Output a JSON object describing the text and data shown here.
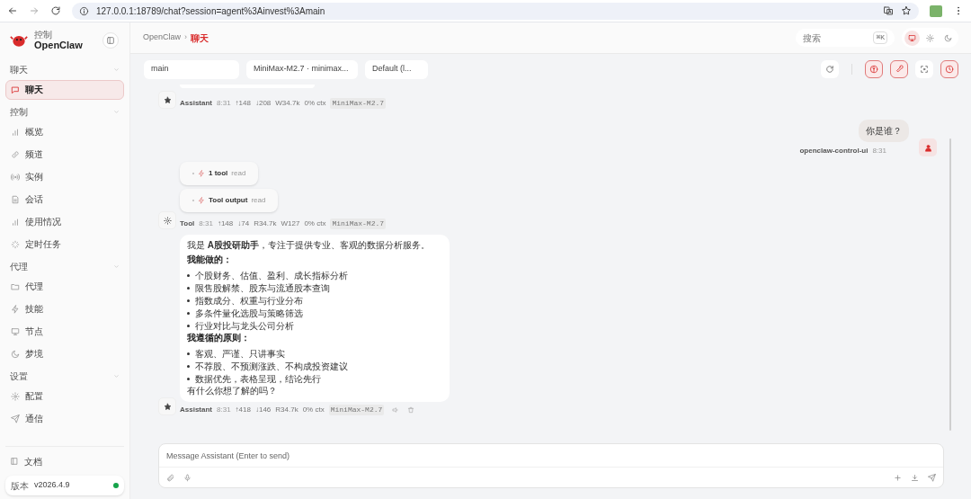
{
  "browser": {
    "url": "127.0.0.1:18789/chat?session=agent%3Ainvest%3Amain"
  },
  "sidebar": {
    "brand_caption": "控制",
    "brand_name": "OpenClaw",
    "sections": [
      {
        "title": "聊天",
        "items": [
          {
            "label": "聊天",
            "selected": true
          }
        ]
      },
      {
        "title": "控制",
        "items": [
          {
            "label": "概览",
            "selected": false
          },
          {
            "label": "频道",
            "selected": false
          },
          {
            "label": "实例",
            "selected": false
          },
          {
            "label": "会话",
            "selected": false
          },
          {
            "label": "使用情况",
            "selected": false
          },
          {
            "label": "定时任务",
            "selected": false
          }
        ]
      },
      {
        "title": "代理",
        "items": [
          {
            "label": "代理",
            "selected": false
          },
          {
            "label": "技能",
            "selected": false
          },
          {
            "label": "节点",
            "selected": false
          },
          {
            "label": "梦境",
            "selected": false
          }
        ]
      },
      {
        "title": "设置",
        "items": [
          {
            "label": "配置",
            "selected": false
          },
          {
            "label": "通信",
            "selected": false
          }
        ]
      }
    ],
    "docs": "文档",
    "version_label": "版本",
    "version": "v2026.4.9",
    "connected": true
  },
  "header": {
    "breadcrumb": [
      "OpenClaw",
      "聊天"
    ],
    "breadcrumb_separator": "›",
    "search": {
      "placeholder": "搜索",
      "shortcut": "⌘K"
    },
    "theme_modes": [
      {
        "selected": true
      },
      {
        "selected": false
      },
      {
        "selected": false
      }
    ]
  },
  "toolbar": {
    "selects": [
      "main",
      "MiniMax-M2.7 · minimax...",
      "Default (l..."
    ],
    "buttons": [
      {
        "active": false
      },
      {
        "active": true
      },
      {
        "active": true
      },
      {
        "active": false
      },
      {
        "active": true
      }
    ]
  },
  "chat": {
    "messages": [
      {
        "kind": "clipped",
        "meta": {
          "role": "Assistant",
          "time": "8:31",
          "stats": [
            "↑148",
            "↓208",
            "W34.7k",
            "0% ctx"
          ],
          "model": "MiniMax-M2.7"
        }
      },
      {
        "kind": "user",
        "text": "你是谁？",
        "meta": {
          "role": "openclaw-control-ui",
          "time": "8:31"
        }
      },
      {
        "kind": "tool",
        "cards": [
          {
            "label": "1 tool",
            "detail": "read"
          },
          {
            "label": "Tool output",
            "detail": "read"
          }
        ],
        "meta": {
          "role": "Tool",
          "time": "8:31",
          "stats": [
            "↑148",
            "↓74",
            "R34.7k",
            "W127",
            "0% ctx"
          ],
          "model": "MiniMax-M2.7"
        }
      },
      {
        "kind": "assistant",
        "show_actions": true,
        "blocks": [
          {
            "kind": "p",
            "text": "我是 **A股投研助手**，专注于提供专业、客观的数据分析服务。"
          },
          {
            "kind": "heading",
            "text": "我能做的："
          },
          {
            "kind": "bullet",
            "text": "个股财务、估值、盈利、成长指标分析"
          },
          {
            "kind": "bullet",
            "text": "限售股解禁、股东与流通股本查询"
          },
          {
            "kind": "bullet",
            "text": "指数成分、权重与行业分布"
          },
          {
            "kind": "bullet",
            "text": "多条件量化选股与策略筛选"
          },
          {
            "kind": "bullet",
            "text": "行业对比与龙头公司分析"
          },
          {
            "kind": "heading",
            "text": "我遵循的原则："
          },
          {
            "kind": "bullet",
            "text": "客观、严谨、只讲事实"
          },
          {
            "kind": "bullet",
            "text": "不荐股、不预测涨跌、不构成投资建议"
          },
          {
            "kind": "bullet",
            "text": "数据优先，表格呈现，结论先行"
          },
          {
            "kind": "p",
            "text": "有什么你想了解的吗？"
          }
        ],
        "meta": {
          "role": "Assistant",
          "time": "8:31",
          "stats": [
            "↑418",
            "↓146",
            "R34.7k",
            "0% ctx"
          ],
          "model": "MiniMax-M2.7"
        }
      }
    ]
  },
  "composer": {
    "placeholder": "Message Assistant (Enter to send)"
  }
}
